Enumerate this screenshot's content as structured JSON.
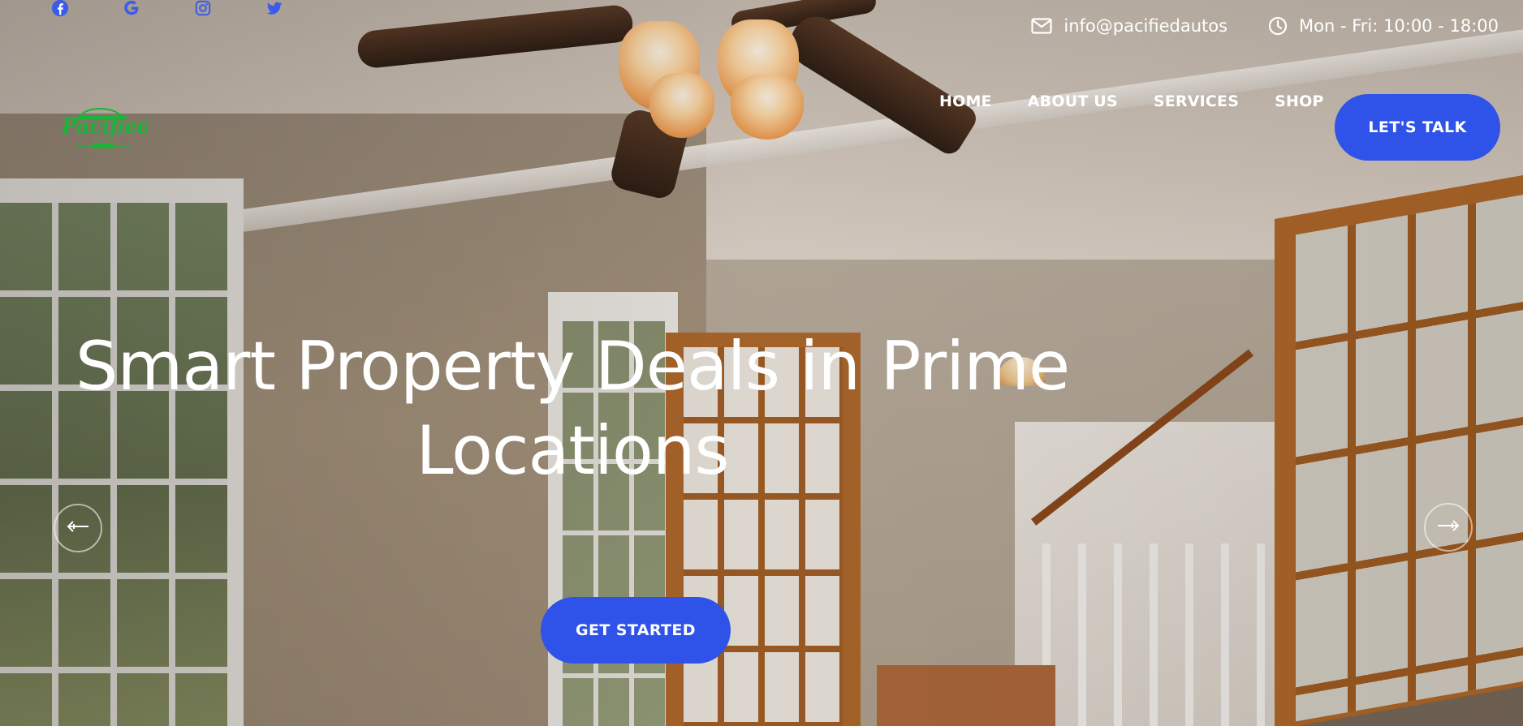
{
  "top_bar": {
    "social_icons": [
      "facebook-icon",
      "google-icon",
      "instagram-icon",
      "twitter-icon"
    ],
    "email": "info@pacifiedautos",
    "hours": "Mon - Fri: 10:00 - 18:00"
  },
  "header": {
    "logo_text": "Pacified",
    "nav": [
      {
        "label": "HOME"
      },
      {
        "label": "ABOUT US"
      },
      {
        "label": "SERVICES"
      },
      {
        "label": "SHOP"
      }
    ],
    "cta_label": "LET'S TALK"
  },
  "hero": {
    "title": "Smart Property Deals in Prime Locations",
    "button_label": "GET STARTED",
    "prev_icon": "arrow-left-icon",
    "next_icon": "arrow-right-icon"
  },
  "colors": {
    "accent": "#2f53e8",
    "logo_green": "#1db33a",
    "text_light": "#ffffff"
  }
}
